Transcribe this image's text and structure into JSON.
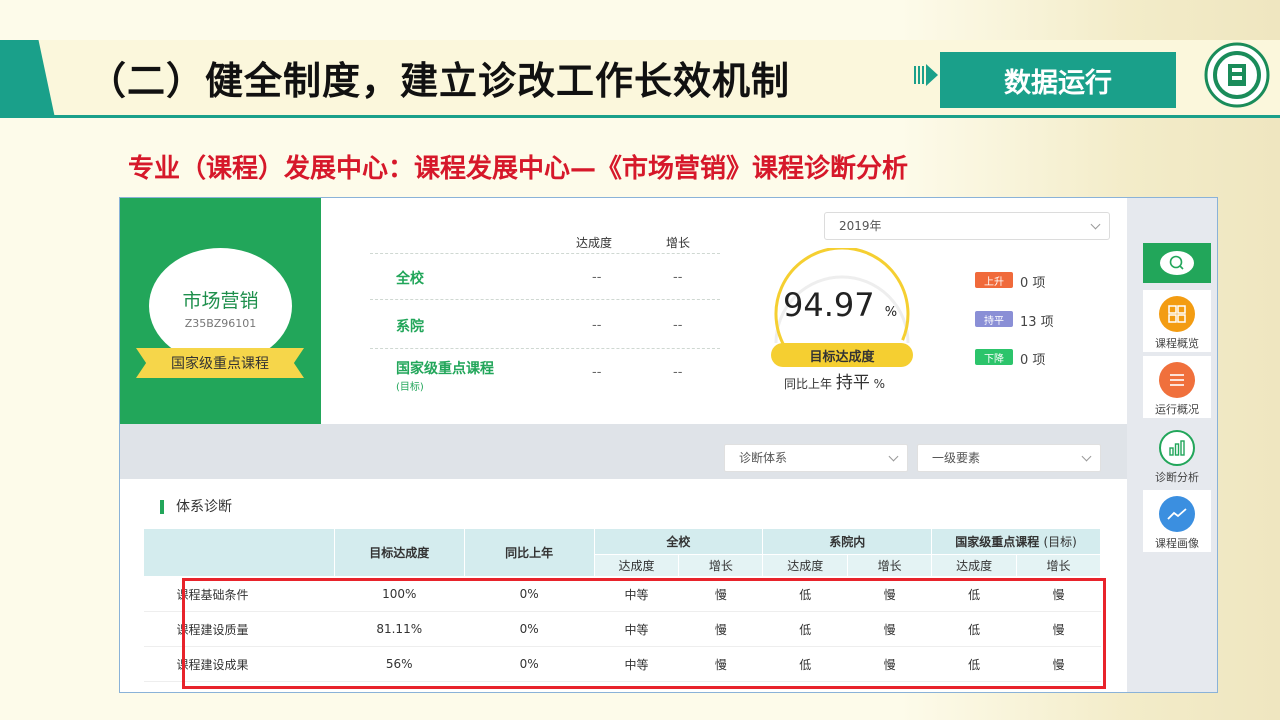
{
  "slide": {
    "title": "（二）健全制度，建立诊改工作长效机制",
    "section_tag": "数据运行",
    "subtitle": "专业（课程）发展中心：课程发展中心—《市场营销》课程诊断分析"
  },
  "course": {
    "name": "市场营销",
    "code": "Z35BZ96101",
    "level": "国家级重点课程"
  },
  "summary": {
    "col_achievement": "达成度",
    "col_growth": "增长",
    "rows": [
      {
        "label": "全校",
        "sub": "",
        "achievement": "--",
        "growth": "--"
      },
      {
        "label": "系院",
        "sub": "",
        "achievement": "--",
        "growth": "--"
      },
      {
        "label": "国家级重点课程",
        "sub": "(目标)",
        "achievement": "--",
        "growth": "--"
      }
    ]
  },
  "year_select": {
    "value": "2019年"
  },
  "gauge": {
    "value": "94.97",
    "unit": "%",
    "fraction": 0.9497,
    "badge": "目标达成度",
    "compare_prefix": "同比上年",
    "compare_value": "持平",
    "compare_unit": "%"
  },
  "trends": [
    {
      "label": "上升",
      "count": "0 项",
      "color": "#f06a3b"
    },
    {
      "label": "持平",
      "count": "13 项",
      "color": "#8a8fd6"
    },
    {
      "label": "下降",
      "count": "0 项",
      "color": "#2cc46b"
    }
  ],
  "filters": {
    "system": "诊断体系",
    "level": "一级要素"
  },
  "sidebar": {
    "items": [
      {
        "label": "课程概览",
        "color": "#f39c12"
      },
      {
        "label": "运行概况",
        "color": "#f0703c"
      },
      {
        "label": "诊断分析",
        "color": "#22a65a"
      },
      {
        "label": "课程画像",
        "color": "#3b8fe0"
      }
    ]
  },
  "diagnosis": {
    "section_title": "体系诊断",
    "headers": {
      "target": "目标达成度",
      "yoy": "同比上年",
      "school": "全校",
      "dept": "系院内",
      "national": "国家级重点课程",
      "national_sub": "(目标)",
      "achievement": "达成度",
      "growth": "增长"
    },
    "rows": [
      {
        "name": "课程基础条件",
        "target": "100%",
        "yoy": "0%",
        "school_ach": "中等",
        "school_gr": "慢",
        "dept_ach": "低",
        "dept_gr": "慢",
        "nat_ach": "低",
        "nat_gr": "慢"
      },
      {
        "name": "课程建设质量",
        "target": "81.11%",
        "yoy": "0%",
        "school_ach": "中等",
        "school_gr": "慢",
        "dept_ach": "低",
        "dept_gr": "慢",
        "nat_ach": "低",
        "nat_gr": "慢"
      },
      {
        "name": "课程建设成果",
        "target": "56%",
        "yoy": "0%",
        "school_ach": "中等",
        "school_gr": "慢",
        "dept_ach": "低",
        "dept_gr": "慢",
        "nat_ach": "低",
        "nat_gr": "慢"
      }
    ]
  }
}
